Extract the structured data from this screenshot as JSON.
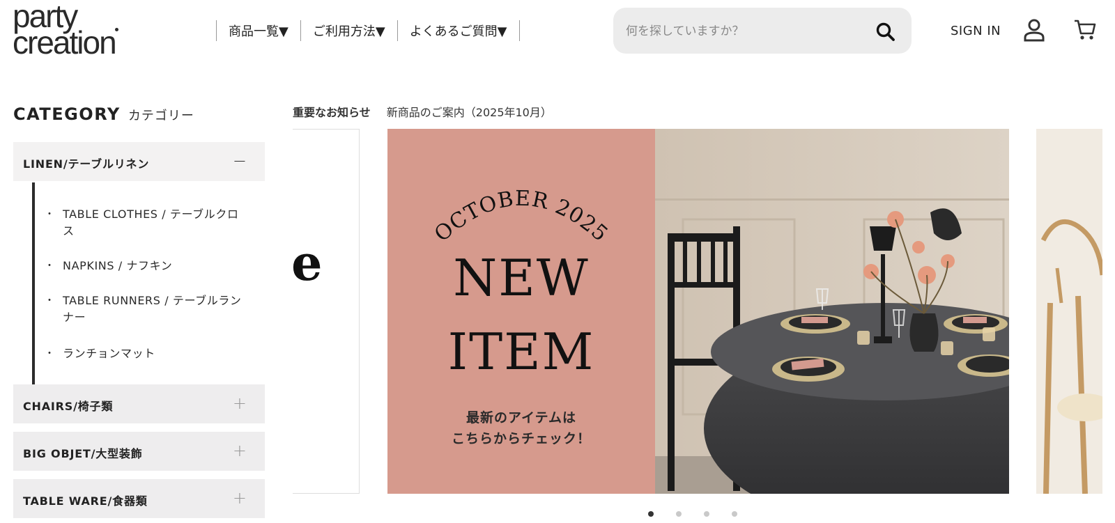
{
  "logo": {
    "line1": "party",
    "line2": "creation"
  },
  "nav": {
    "items": [
      {
        "label": "商品一覧▼"
      },
      {
        "label": "ご利用方法▼"
      },
      {
        "label": "よくあるご質問▼"
      }
    ]
  },
  "search": {
    "placeholder": "何を探していますか？",
    "icon": "search-icon"
  },
  "header": {
    "signin_label": "SIGN IN",
    "user_icon": "user-icon",
    "cart_icon": "cart-icon"
  },
  "sidebar": {
    "title_en": "CATEGORY",
    "title_jp": "カテゴリー",
    "categories": [
      {
        "label": "LINEN/テーブルリネン",
        "state": "−",
        "expanded": true,
        "subitems": [
          {
            "bullet": "・",
            "label": "TABLE CLOTHES / テーブルクロス"
          },
          {
            "bullet": "・",
            "label": "NAPKINS / ナフキン"
          },
          {
            "bullet": "・",
            "label": "TABLE RUNNERS / テーブルランナー"
          },
          {
            "bullet": "・",
            "label": "ランチョンマット"
          }
        ]
      },
      {
        "label": "CHAIRS/椅子類",
        "state": "+",
        "expanded": false
      },
      {
        "label": "BIG OBJET/大型装飾",
        "state": "+",
        "expanded": false
      },
      {
        "label": "TABLE WARE/食器類",
        "state": "+",
        "expanded": false
      }
    ]
  },
  "notice": {
    "label": "重要なお知らせ",
    "text": "新商品のご案内（2025年10月）"
  },
  "banner": {
    "prev_slide_glyph": "e",
    "arc_text": "OCTOBER 2025",
    "line1": "NEW",
    "line2": "ITEM",
    "sub1": "最新のアイテムは",
    "sub2": "こちらからチェック！",
    "bg_color": "#d69a8d"
  },
  "carousel": {
    "slide_count": 4,
    "active_index": 0
  }
}
